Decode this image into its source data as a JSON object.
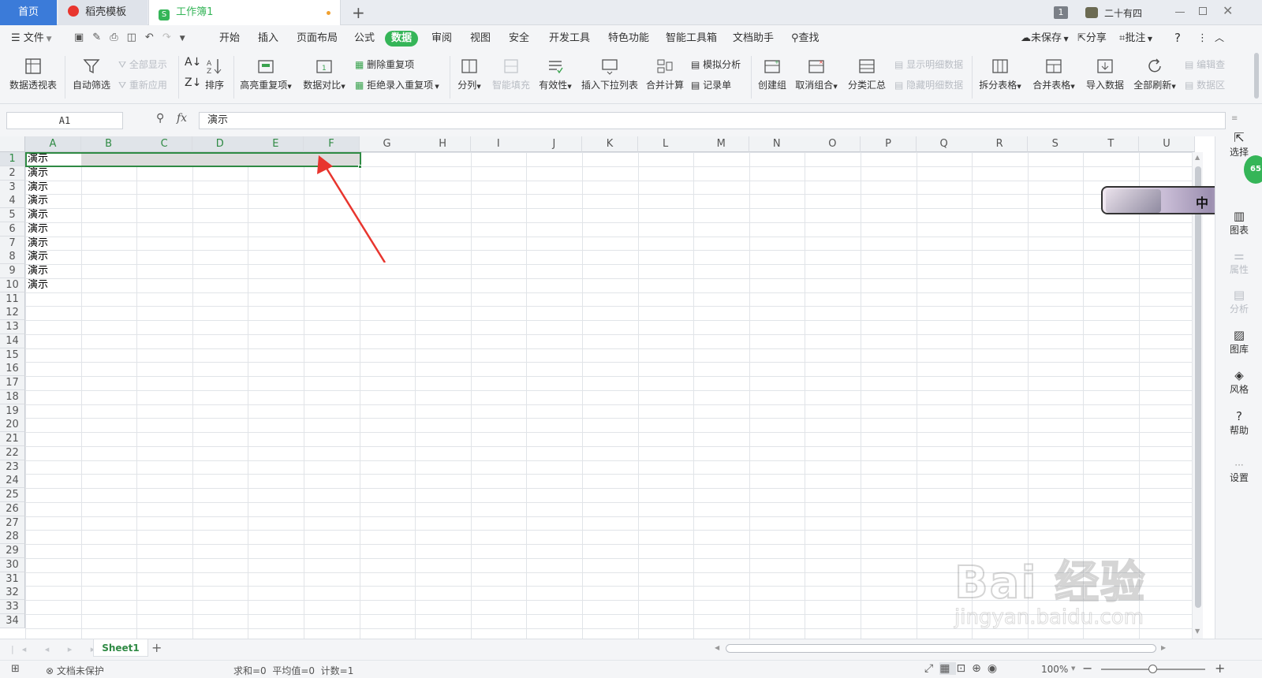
{
  "tabs": {
    "home": "首页",
    "template": "稻壳模板",
    "workbook": "工作簿1",
    "new_tab": "+",
    "badge": "1",
    "user": "二十有四"
  },
  "menu": {
    "file": "文件",
    "items": [
      "开始",
      "插入",
      "页面布局",
      "公式",
      "数据",
      "审阅",
      "视图",
      "安全",
      "开发工具",
      "特色功能",
      "智能工具箱",
      "文档助手"
    ],
    "search": "查找",
    "unsaved": "未保存",
    "share": "分享",
    "comment": "批注"
  },
  "ribbon": {
    "pivot": "数据透视表",
    "autofilter": "自动筛选",
    "show_all": "全部显示",
    "reapply": "重新应用",
    "sort": "排序",
    "highlight_dup": "高亮重复项",
    "compare": "数据对比",
    "remove_dup": "删除重复项",
    "reject_dup": "拒绝录入重复项",
    "split_col": "分列",
    "smart_fill": "智能填充",
    "validity": "有效性",
    "insert_dropdown": "插入下拉列表",
    "merge_calc": "合并计算",
    "simulate": "模拟分析",
    "record": "记录单",
    "create_group": "创建组",
    "ungroup": "取消组合",
    "subtotal": "分类汇总",
    "show_detail": "显示明细数据",
    "hide_detail": "隐藏明细数据",
    "split_table": "拆分表格",
    "merge_table": "合并表格",
    "import": "导入数据",
    "refresh_all": "全部刷新",
    "edit_query": "编辑查",
    "data_conn": "数据区"
  },
  "formula_bar": {
    "name_box": "A1",
    "fx": "fx",
    "value": "演示"
  },
  "grid": {
    "columns": [
      "A",
      "B",
      "C",
      "D",
      "E",
      "F",
      "G",
      "H",
      "I",
      "J",
      "K",
      "L",
      "M",
      "N",
      "O",
      "P",
      "Q",
      "R",
      "S",
      "T",
      "U"
    ],
    "rows": [
      "1",
      "2",
      "3",
      "4",
      "5",
      "6",
      "7",
      "8",
      "9",
      "10",
      "11",
      "12",
      "13",
      "14",
      "15",
      "16",
      "17",
      "18",
      "19",
      "20",
      "21",
      "22",
      "23",
      "24",
      "25",
      "26",
      "27",
      "28",
      "29",
      "30",
      "31",
      "32",
      "33",
      "34"
    ],
    "cells": [
      "演示",
      "演示",
      "演示",
      "演示",
      "演示",
      "演示",
      "演示",
      "演示",
      "演示",
      "演示"
    ],
    "selected_range": "A1:F1",
    "accent_color": "#2f8a44",
    "arrow_color": "#e8352e"
  },
  "right_panel": {
    "select": "选择",
    "badge": "65",
    "ime": "中",
    "chart": "图表",
    "property": "属性",
    "analysis": "分析",
    "gallery": "图库",
    "style": "风格",
    "help": "帮助",
    "more": "···",
    "settings": "设置"
  },
  "sheets": {
    "sheet1": "Sheet1",
    "add": "+"
  },
  "status": {
    "protect": "文档未保护",
    "summary": "求和=0  平均值=0  计数=1",
    "zoom": "100%"
  },
  "watermark": {
    "brand": "Bai 经验",
    "url": "jingyan.baidu.com"
  }
}
